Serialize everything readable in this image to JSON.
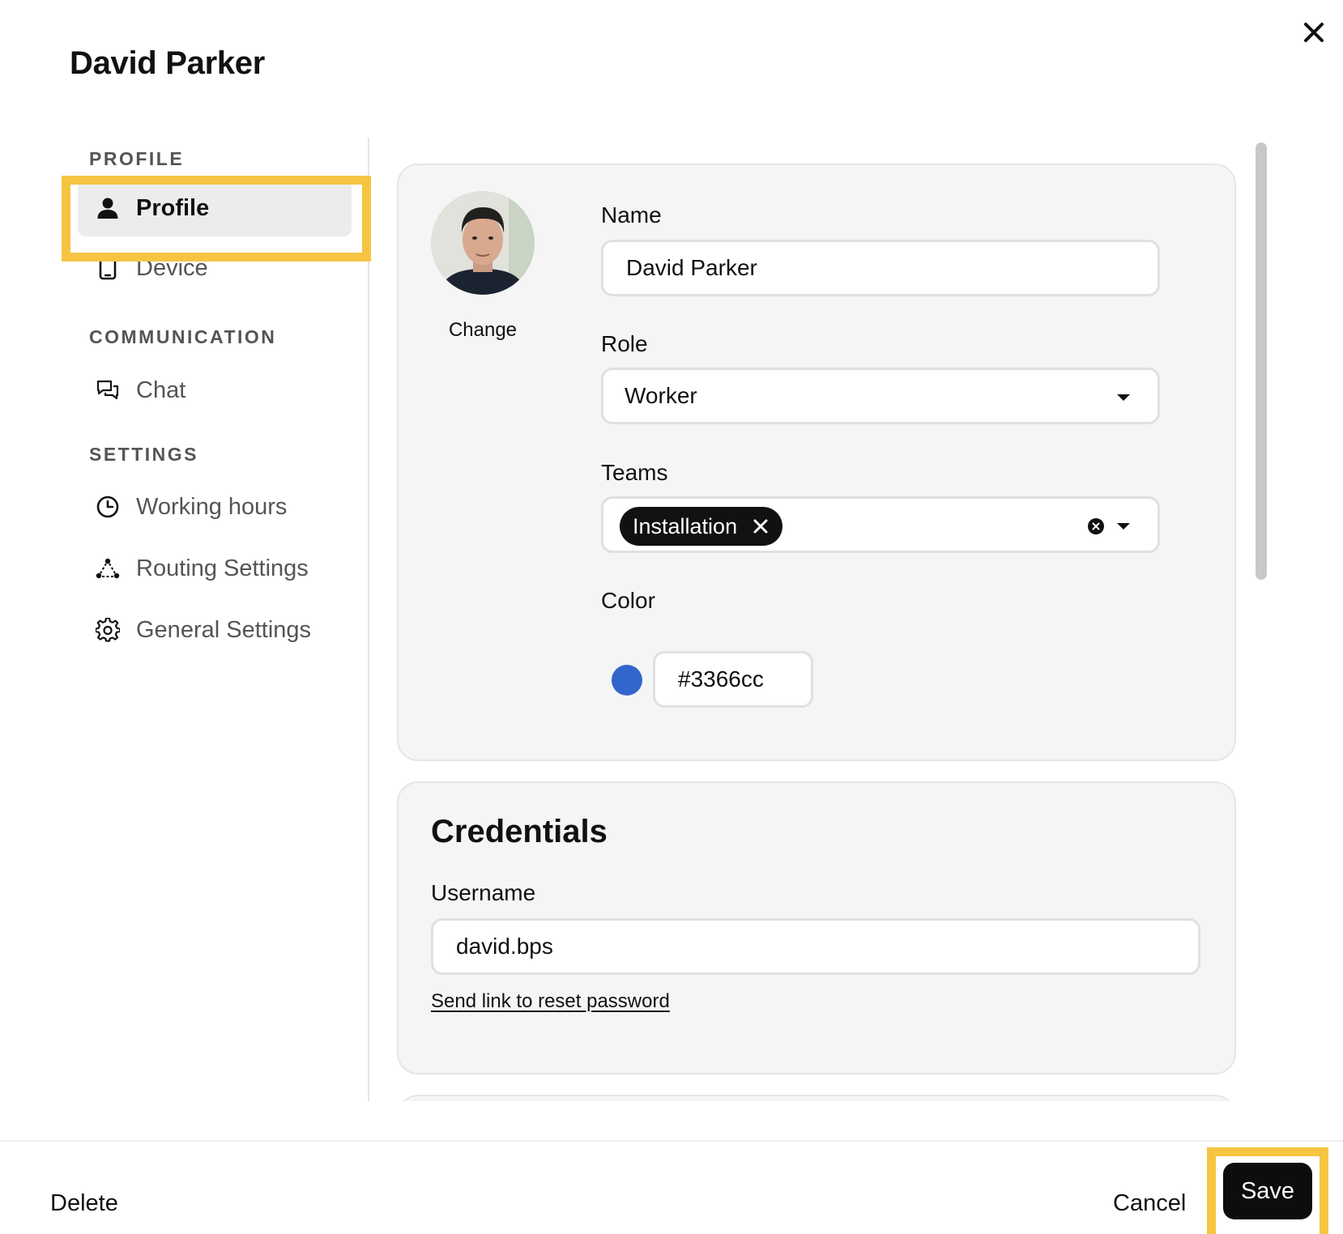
{
  "modal": {
    "title": "David Parker"
  },
  "sidebar": {
    "sections": [
      {
        "heading": "PROFILE",
        "items": [
          {
            "label": "Profile",
            "icon": "person-icon"
          },
          {
            "label": "Device",
            "icon": "phone-icon"
          }
        ]
      },
      {
        "heading": "COMMUNICATION",
        "items": [
          {
            "label": "Chat",
            "icon": "chat-bubbles-icon"
          }
        ]
      },
      {
        "heading": "SETTINGS",
        "items": [
          {
            "label": "Working hours",
            "icon": "clock-icon"
          },
          {
            "label": "Routing Settings",
            "icon": "routing-nodes-icon"
          },
          {
            "label": "General Settings",
            "icon": "gear-icon"
          }
        ]
      }
    ],
    "active_item": "Profile"
  },
  "profile": {
    "avatar_change_label": "Change",
    "name": {
      "label": "Name",
      "value": "David Parker"
    },
    "role": {
      "label": "Role",
      "value": "Worker"
    },
    "teams": {
      "label": "Teams",
      "selected": [
        "Installation"
      ]
    },
    "color": {
      "label": "Color",
      "value": "#3366cc"
    }
  },
  "credentials": {
    "title": "Credentials",
    "username": {
      "label": "Username",
      "value": "david.bps"
    },
    "reset_link": "Send link to reset password"
  },
  "footer": {
    "delete_label": "Delete",
    "cancel_label": "Cancel",
    "save_label": "Save"
  },
  "colors": {
    "highlight": "#f5c542",
    "primary_button": "#0d0d0d",
    "card_background": "#f5f5f5"
  }
}
